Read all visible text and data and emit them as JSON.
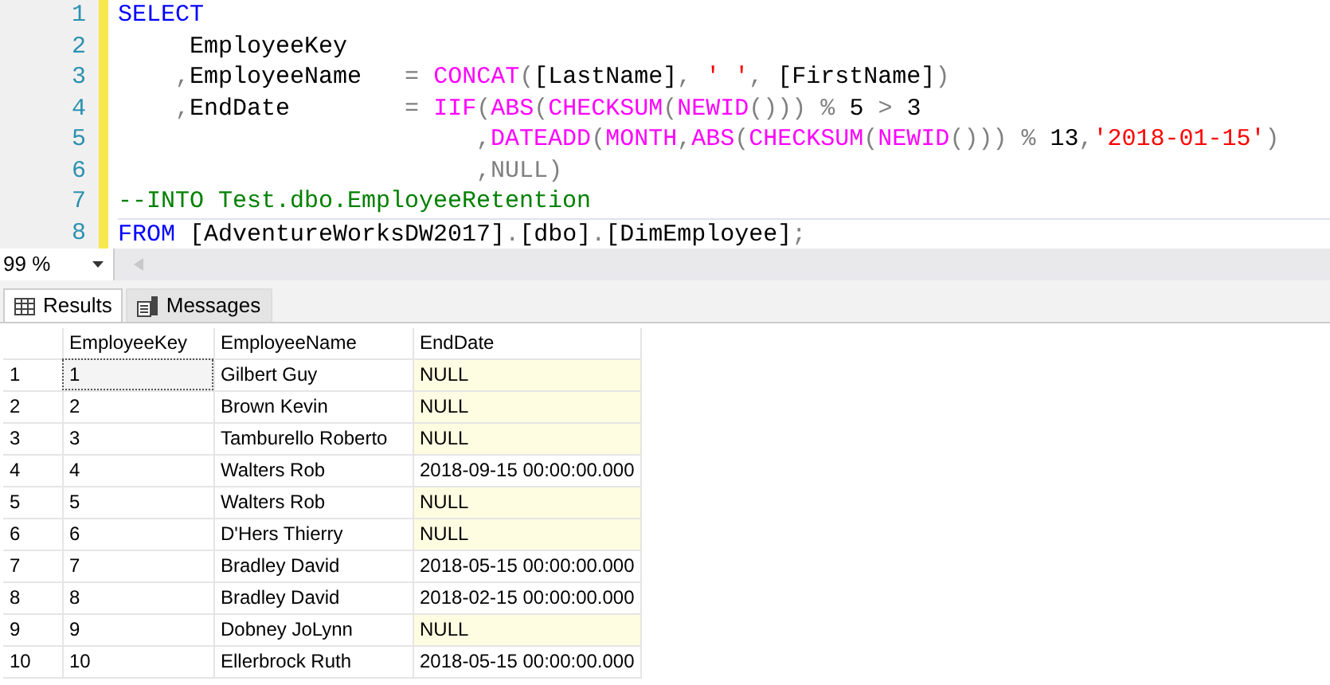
{
  "editor": {
    "lines": [
      {
        "number": "1",
        "tokens": [
          {
            "kind": "keyword",
            "text": "SELECT"
          }
        ]
      },
      {
        "number": "2",
        "tokens": [
          {
            "kind": "plain",
            "text": "     EmployeeKey"
          }
        ]
      },
      {
        "number": "3",
        "tokens": [
          {
            "kind": "operator",
            "text": "    ,"
          },
          {
            "kind": "plain",
            "text": "EmployeeName   "
          },
          {
            "kind": "operator",
            "text": "= "
          },
          {
            "kind": "function",
            "text": "CONCAT"
          },
          {
            "kind": "operator",
            "text": "("
          },
          {
            "kind": "plain",
            "text": "[LastName]"
          },
          {
            "kind": "operator",
            "text": ", "
          },
          {
            "kind": "string",
            "text": "' '"
          },
          {
            "kind": "operator",
            "text": ", "
          },
          {
            "kind": "plain",
            "text": "[FirstName]"
          },
          {
            "kind": "operator",
            "text": ")"
          }
        ]
      },
      {
        "number": "4",
        "tokens": [
          {
            "kind": "operator",
            "text": "    ,"
          },
          {
            "kind": "plain",
            "text": "EndDate        "
          },
          {
            "kind": "operator",
            "text": "= "
          },
          {
            "kind": "function",
            "text": "IIF"
          },
          {
            "kind": "operator",
            "text": "("
          },
          {
            "kind": "function",
            "text": "ABS"
          },
          {
            "kind": "operator",
            "text": "("
          },
          {
            "kind": "function",
            "text": "CHECKSUM"
          },
          {
            "kind": "operator",
            "text": "("
          },
          {
            "kind": "function",
            "text": "NEWID"
          },
          {
            "kind": "operator",
            "text": "())) % "
          },
          {
            "kind": "plain",
            "text": "5 "
          },
          {
            "kind": "operator",
            "text": "> "
          },
          {
            "kind": "plain",
            "text": "3"
          }
        ]
      },
      {
        "number": "5",
        "tokens": [
          {
            "kind": "operator",
            "text": "                         ,"
          },
          {
            "kind": "function",
            "text": "DATEADD"
          },
          {
            "kind": "operator",
            "text": "("
          },
          {
            "kind": "function",
            "text": "MONTH"
          },
          {
            "kind": "operator",
            "text": ","
          },
          {
            "kind": "function",
            "text": "ABS"
          },
          {
            "kind": "operator",
            "text": "("
          },
          {
            "kind": "function",
            "text": "CHECKSUM"
          },
          {
            "kind": "operator",
            "text": "("
          },
          {
            "kind": "function",
            "text": "NEWID"
          },
          {
            "kind": "operator",
            "text": "())) % "
          },
          {
            "kind": "plain",
            "text": "13"
          },
          {
            "kind": "operator",
            "text": ","
          },
          {
            "kind": "string",
            "text": "'2018-01-15'"
          },
          {
            "kind": "operator",
            "text": ")"
          }
        ]
      },
      {
        "number": "6",
        "tokens": [
          {
            "kind": "operator",
            "text": "                         ,"
          },
          {
            "kind": "keyword_gray",
            "text": "NULL"
          },
          {
            "kind": "operator",
            "text": ")"
          }
        ]
      },
      {
        "number": "7",
        "tokens": [
          {
            "kind": "comment",
            "text": "--INTO Test.dbo.EmployeeRetention"
          }
        ]
      },
      {
        "number": "8",
        "tokens": [
          {
            "kind": "keyword",
            "text": "FROM "
          },
          {
            "kind": "plain",
            "text": "[AdventureWorksDW2017]"
          },
          {
            "kind": "operator",
            "text": "."
          },
          {
            "kind": "plain",
            "text": "[dbo]"
          },
          {
            "kind": "operator",
            "text": "."
          },
          {
            "kind": "plain",
            "text": "[DimEmployee]"
          },
          {
            "kind": "operator",
            "text": ";"
          }
        ]
      }
    ]
  },
  "zoom": {
    "value": "99 %"
  },
  "tabs": [
    {
      "label": "Results",
      "selected": true
    },
    {
      "label": "Messages",
      "selected": false
    }
  ],
  "table": {
    "columns": [
      "EmployeeKey",
      "EmployeeName",
      "EndDate"
    ],
    "rows": [
      {
        "number": "1",
        "key": "1",
        "name": "Gilbert Guy",
        "end_date": "NULL",
        "is_null": true
      },
      {
        "number": "2",
        "key": "2",
        "name": "Brown Kevin",
        "end_date": "NULL",
        "is_null": true
      },
      {
        "number": "3",
        "key": "3",
        "name": "Tamburello Roberto",
        "end_date": "NULL",
        "is_null": true
      },
      {
        "number": "4",
        "key": "4",
        "name": "Walters Rob",
        "end_date": "2018-09-15 00:00:00.000",
        "is_null": false
      },
      {
        "number": "5",
        "key": "5",
        "name": "Walters Rob",
        "end_date": "NULL",
        "is_null": true
      },
      {
        "number": "6",
        "key": "6",
        "name": "D'Hers Thierry",
        "end_date": "NULL",
        "is_null": true
      },
      {
        "number": "7",
        "key": "7",
        "name": "Bradley David",
        "end_date": "2018-05-15 00:00:00.000",
        "is_null": false
      },
      {
        "number": "8",
        "key": "8",
        "name": "Bradley David",
        "end_date": "2018-02-15 00:00:00.000",
        "is_null": false
      },
      {
        "number": "9",
        "key": "9",
        "name": "Dobney JoLynn",
        "end_date": "NULL",
        "is_null": true
      },
      {
        "number": "10",
        "key": "10",
        "name": "Ellerbrock Ruth",
        "end_date": "2018-05-15 00:00:00.000",
        "is_null": false
      }
    ]
  }
}
